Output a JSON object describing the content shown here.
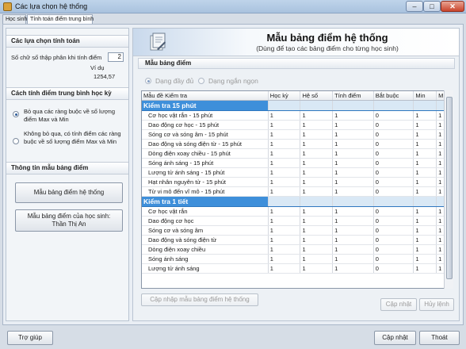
{
  "window": {
    "title": "Các lựa chọn hệ thống",
    "minimize_glyph": "‒",
    "maximize_glyph": "□",
    "close_glyph": "✕"
  },
  "tabs": [
    {
      "label": "Học sinh"
    },
    {
      "label": "Tính toán điểm trung bình"
    }
  ],
  "left": {
    "section1_title": "Các lựa chọn tính toán",
    "decimal_label": "Số chữ số thập phân khi tính điểm",
    "decimal_value": "2",
    "example_label": "Ví dụ",
    "example_value": "1254,57",
    "section2_title": "Cách tính điểm trung bình học kỳ",
    "option1": "Bỏ qua các ràng buộc về số lượng điểm Max và Min",
    "option2": "Không bỏ qua, có tính điểm các ràng buộc về số lượng điểm Max và Min",
    "section3_title": "Thông tin mẫu bảng điểm",
    "btn_system_template": "Mẫu bảng điểm hệ thống",
    "btn_student_template_line1": "Mẫu bảng điểm của học sinh:",
    "btn_student_template_line2": "Thần Thị An"
  },
  "right": {
    "title": "Mẫu bảng điểm hệ thống",
    "subtitle": "(Dùng để tạo các bảng điểm cho từng học sinh)",
    "group_title": "Mẫu bảng điểm",
    "radio_full": "Dạng đầy đủ",
    "radio_short": "Dạng ngắn ngọn",
    "columns": [
      "Mẫu đề Kiểm tra",
      "Học kỳ",
      "Hệ số",
      "Tính điểm",
      "Bắt buộc",
      "Min",
      "M"
    ],
    "groups": [
      {
        "name": "Kiểm tra 15 phút",
        "rows": [
          {
            "name": "Cơ học vật rắn - 15 phút",
            "hk": "1",
            "hs": "1",
            "td": "1",
            "bb": "0",
            "min": "1",
            "m": "1"
          },
          {
            "name": "Dao động cơ học - 15 phút",
            "hk": "1",
            "hs": "1",
            "td": "1",
            "bb": "0",
            "min": "1",
            "m": "1"
          },
          {
            "name": "Sóng cơ và sóng âm - 15 phút",
            "hk": "1",
            "hs": "1",
            "td": "1",
            "bb": "0",
            "min": "1",
            "m": "1"
          },
          {
            "name": "Dao động và sóng điện từ - 15 phút",
            "hk": "1",
            "hs": "1",
            "td": "1",
            "bb": "0",
            "min": "1",
            "m": "1"
          },
          {
            "name": "Dòng điện xoay chiều - 15 phút",
            "hk": "1",
            "hs": "1",
            "td": "1",
            "bb": "0",
            "min": "1",
            "m": "1"
          },
          {
            "name": "Sóng ánh sáng - 15 phút",
            "hk": "1",
            "hs": "1",
            "td": "1",
            "bb": "0",
            "min": "1",
            "m": "1"
          },
          {
            "name": "Lượng tử ánh sáng - 15 phút",
            "hk": "1",
            "hs": "1",
            "td": "1",
            "bb": "0",
            "min": "1",
            "m": "1"
          },
          {
            "name": "Hạt nhân nguyên tử - 15 phút",
            "hk": "1",
            "hs": "1",
            "td": "1",
            "bb": "0",
            "min": "1",
            "m": "1"
          },
          {
            "name": "Từ vi mô đến vĩ mô - 15 phút",
            "hk": "1",
            "hs": "1",
            "td": "1",
            "bb": "0",
            "min": "1",
            "m": "1"
          }
        ]
      },
      {
        "name": "Kiểm tra 1 tiết",
        "rows": [
          {
            "name": "Cơ học vật rắn",
            "hk": "1",
            "hs": "1",
            "td": "1",
            "bb": "0",
            "min": "1",
            "m": "1"
          },
          {
            "name": "Dao động cơ học",
            "hk": "1",
            "hs": "1",
            "td": "1",
            "bb": "0",
            "min": "1",
            "m": "1"
          },
          {
            "name": "Sóng cơ và sóng âm",
            "hk": "1",
            "hs": "1",
            "td": "1",
            "bb": "0",
            "min": "1",
            "m": "1"
          },
          {
            "name": "Dao động và sóng điện từ",
            "hk": "1",
            "hs": "1",
            "td": "1",
            "bb": "0",
            "min": "1",
            "m": "1"
          },
          {
            "name": "Dòng điện xoay chiều",
            "hk": "1",
            "hs": "1",
            "td": "1",
            "bb": "0",
            "min": "1",
            "m": "1"
          },
          {
            "name": "Sóng ánh sáng",
            "hk": "1",
            "hs": "1",
            "td": "1",
            "bb": "0",
            "min": "1",
            "m": "1"
          },
          {
            "name": "Lượng tử ánh sáng",
            "hk": "1",
            "hs": "1",
            "td": "1",
            "bb": "0",
            "min": "1",
            "m": "1"
          }
        ]
      }
    ],
    "btn_refresh_template": "Cập nhập mẫu bảng điểm hệ thống",
    "btn_update": "Cập nhật",
    "btn_cancel": "Hủy lệnh"
  },
  "footer": {
    "help": "Trợ giúp",
    "update": "Cập nhật",
    "exit": "Thoát"
  }
}
